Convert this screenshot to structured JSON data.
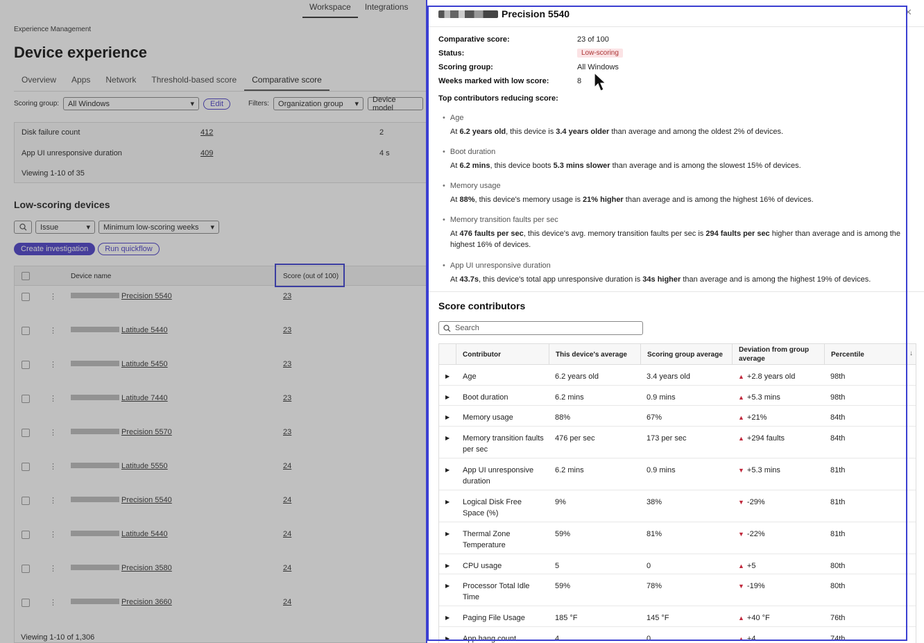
{
  "background": {
    "top_tabs": [
      "Workspace",
      "Integrations"
    ],
    "breadcrumb": "Experience Management",
    "title": "Device experience",
    "tabs": [
      "Overview",
      "Apps",
      "Network",
      "Threshold-based score",
      "Comparative score"
    ],
    "scoring_group_label": "Scoring group:",
    "scoring_group_value": "All Windows",
    "edit_label": "Edit",
    "filters_label": "Filters:",
    "filter_org": "Organization group",
    "filter_device_model": "Device model",
    "summary_rows": [
      {
        "name": "Disk failure count",
        "count": "412",
        "value": "2"
      },
      {
        "name": "App UI unresponsive duration",
        "count": "409",
        "value": "4 s"
      }
    ],
    "summary_viewing": "Viewing 1-10 of 35",
    "low_scoring_title": "Low-scoring devices",
    "issue_filter": "Issue",
    "min_weeks_filter": "Minimum low-scoring weeks",
    "create_investigation": "Create investigation",
    "run_quickflow": "Run quickflow",
    "col_device_name": "Device name",
    "col_score": "Score (out of 100)",
    "devices": [
      {
        "name": "Precision 5540",
        "score": "23"
      },
      {
        "name": "Latitude 5440",
        "score": "23"
      },
      {
        "name": "Latitude 5450",
        "score": "23"
      },
      {
        "name": "Latitude 7440",
        "score": "23"
      },
      {
        "name": "Precision 5570",
        "score": "23"
      },
      {
        "name": "Latitude 5550",
        "score": "24"
      },
      {
        "name": "Precision 5540",
        "score": "24"
      },
      {
        "name": "Latitude 5440",
        "score": "24"
      },
      {
        "name": "Precision 3580",
        "score": "24"
      },
      {
        "name": "Precision 3660",
        "score": "24"
      }
    ],
    "devices_viewing": "Viewing 1-10 of 1,306"
  },
  "panel": {
    "title": "Precision 5540",
    "comparative_score_label": "Comparative score:",
    "comparative_score_value": "23 of 100",
    "status_label": "Status:",
    "status_value": "Low-scoring",
    "scoring_group_label": "Scoring group:",
    "scoring_group_value": "All Windows",
    "weeks_label": "Weeks marked with low score:",
    "weeks_value": "8",
    "top_contributors_label": "Top contributors reducing score:",
    "contributors": [
      {
        "name": "Age",
        "p1": "At ",
        "b1": "6.2 years old",
        "p2": ", this device is ",
        "b2": "3.4 years older",
        "p3": " than average and among the oldest 2% of devices."
      },
      {
        "name": "Boot duration",
        "p1": "At ",
        "b1": "6.2 mins",
        "p2": ", this device boots ",
        "b2": "5.3 mins slower",
        "p3": " than average and is among the slowest 15% of devices."
      },
      {
        "name": "Memory usage",
        "p1": "At ",
        "b1": "88%",
        "p2": ", this device's memory usage is ",
        "b2": "21% higher",
        "p3": " than average and is among the highest 16% of devices."
      },
      {
        "name": "Memory transition faults per sec",
        "p1": "At ",
        "b1": "476 faults per sec",
        "p2": ", this device's avg. memory transition faults per sec is ",
        "b2": "294 faults per sec",
        "p3": " higher than average and is among the highest 16% of devices."
      },
      {
        "name": "App UI unresponsive duration",
        "p1": "At ",
        "b1": "43.7s",
        "p2": ", this device's total app unresponsive duration is ",
        "b2": "34s higher",
        "p3": " than average and is among the highest 19% of devices."
      }
    ],
    "score_contributors_title": "Score contributors",
    "search_placeholder": "Search",
    "columns": [
      "Contributor",
      "This device's average",
      "Scoring group average",
      "Deviation from group average",
      "Percentile"
    ],
    "rows": [
      {
        "contributor": "Age",
        "device": "6.2 years old",
        "group": "3.4 years old",
        "dir": "up",
        "deviation": "+2.8 years old",
        "percentile": "98th"
      },
      {
        "contributor": "Boot duration",
        "device": "6.2 mins",
        "group": "0.9 mins",
        "dir": "up",
        "deviation": "+5.3 mins",
        "percentile": "98th"
      },
      {
        "contributor": "Memory usage",
        "device": "88%",
        "group": "67%",
        "dir": "up",
        "deviation": "+21%",
        "percentile": "84th"
      },
      {
        "contributor": "Memory transition faults per sec",
        "device": "476 per sec",
        "group": "173 per sec",
        "dir": "up",
        "deviation": "+294 faults",
        "percentile": "84th"
      },
      {
        "contributor": "App UI unresponsive duration",
        "device": "6.2 mins",
        "group": "0.9 mins",
        "dir": "down",
        "deviation": "+5.3 mins",
        "percentile": "81th"
      },
      {
        "contributor": "Logical Disk Free Space (%)",
        "device": "9%",
        "group": "38%",
        "dir": "down",
        "deviation": "-29%",
        "percentile": "81th"
      },
      {
        "contributor": "Thermal Zone Temperature",
        "device": "59%",
        "group": "81%",
        "dir": "down",
        "deviation": "-22%",
        "percentile": "81th"
      },
      {
        "contributor": "CPU usage",
        "device": "5",
        "group": "0",
        "dir": "up",
        "deviation": "+5",
        "percentile": "80th"
      },
      {
        "contributor": "Processor Total Idle Time",
        "device": "59%",
        "group": "78%",
        "dir": "down",
        "deviation": "-19%",
        "percentile": "80th"
      },
      {
        "contributor": "Paging File Usage",
        "device": "185 °F",
        "group": "145 °F",
        "dir": "up",
        "deviation": "+40 °F",
        "percentile": "76th"
      },
      {
        "contributor": "App hang count",
        "device": "4",
        "group": "0",
        "dir": "up",
        "deviation": "+4",
        "percentile": "74th"
      }
    ]
  },
  "colors": {
    "accent": "#4a3fc9",
    "highlight": "#3b3fd1",
    "badge_bg": "#fbe3e5",
    "arrow": "#c0273b"
  }
}
